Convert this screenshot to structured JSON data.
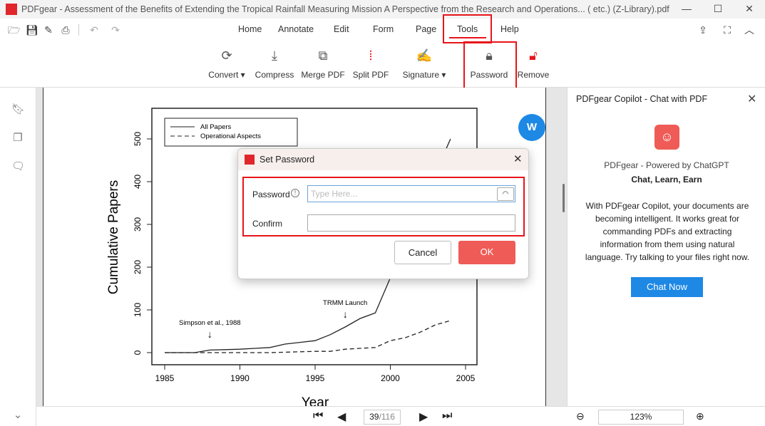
{
  "window": {
    "title": "PDFgear - Assessment of the Benefits of Extending the Tropical Rainfall Measuring Mission A Perspective from the Research and Operations... ( etc.) (Z-Library).pdf",
    "logo_text": "PDF"
  },
  "menu": {
    "tabs": [
      "Home",
      "Annotate",
      "Edit",
      "Form",
      "Page",
      "Tools",
      "Help"
    ],
    "active": "Tools"
  },
  "toolbar": {
    "tools": [
      {
        "label": "Convert",
        "dropdown": true
      },
      {
        "label": "Compress"
      },
      {
        "label": "Merge PDF"
      },
      {
        "label": "Split PDF"
      },
      {
        "label": "Signature",
        "dropdown": true
      },
      {
        "label": "Password"
      },
      {
        "label": "Remove"
      }
    ]
  },
  "document": {
    "chart_data": {
      "type": "line",
      "xlabel": "Year",
      "ylabel": "Cumulative Papers",
      "xlim": [
        1985,
        2005
      ],
      "ylim": [
        0,
        500
      ],
      "xticks": [
        "1985",
        "1990",
        "1995",
        "2000",
        "2005"
      ],
      "yticks": [
        "0",
        "100",
        "200",
        "300",
        "400",
        "500"
      ],
      "legend": "top-left",
      "x": [
        1985,
        1986,
        1987,
        1988,
        1989,
        1990,
        1991,
        1992,
        1993,
        1994,
        1995,
        1996,
        1997,
        1998,
        1999,
        2000,
        2001,
        2002,
        2003,
        2004
      ],
      "series": [
        {
          "name": "All Papers",
          "style": "solid",
          "values": [
            0,
            0,
            0,
            6,
            7,
            8,
            10,
            12,
            20,
            24,
            28,
            42,
            60,
            80,
            93,
            175,
            250,
            330,
            420,
            500
          ]
        },
        {
          "name": "Operational Aspects",
          "style": "dashed",
          "values": [
            0,
            0,
            0,
            0,
            0,
            0,
            0,
            0,
            1,
            2,
            3,
            3,
            8,
            10,
            12,
            28,
            35,
            48,
            65,
            75
          ]
        }
      ],
      "annotations": [
        {
          "text": "Simpson et al., 1988",
          "x": 1988
        },
        {
          "text": "TRMM Launch",
          "x": 1997
        }
      ]
    }
  },
  "dialog": {
    "title": "Set Password",
    "password_label": "Password",
    "password_placeholder": "Type Here...",
    "confirm_label": "Confirm",
    "cancel": "Cancel",
    "ok": "OK"
  },
  "copilot": {
    "title": "PDFgear Copilot - Chat with PDF",
    "powered": "PDFgear - Powered by ChatGPT",
    "tagline": "Chat, Learn, Earn",
    "description": "With PDFgear Copilot, your documents are becoming intelligent. It works great for commanding PDFs and extracting information from them using natural language. Try talking to your files right now.",
    "button": "Chat Now"
  },
  "nav": {
    "current_page": "39",
    "total_pages": "/116",
    "zoom": "123%"
  },
  "colors": {
    "accent": "#e8141b",
    "ok": "#ef5b56",
    "chat": "#1e88e5"
  }
}
